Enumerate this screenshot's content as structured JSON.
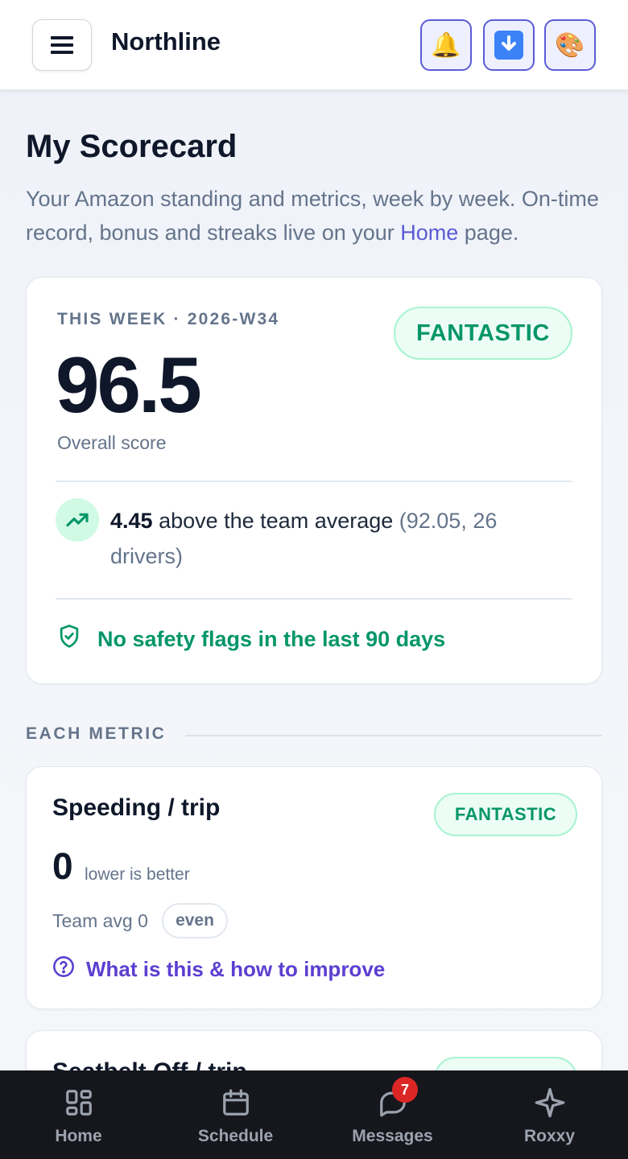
{
  "header": {
    "app_title": "Northline",
    "buttons": [
      {
        "icon": "bell-icon",
        "glyph": "🔔"
      },
      {
        "icon": "download-icon",
        "glyph": "⬇"
      },
      {
        "icon": "palette-icon",
        "glyph": "🎨"
      }
    ]
  },
  "page": {
    "title": "My Scorecard",
    "desc_before": "Your Amazon standing and metrics, week by week. On-time record, bonus and streaks live on your ",
    "desc_link": "Home",
    "desc_after": " page."
  },
  "summary": {
    "week_label": "THIS WEEK · 2026-W34",
    "score": "96.5",
    "score_label": "Overall score",
    "tier": "FANTASTIC",
    "delta": "4.45",
    "delta_text": " above the team average ",
    "team_info": "(92.05, 26 drivers)",
    "safety": "No safety flags in the last 90 days"
  },
  "section": {
    "label": "EACH METRIC"
  },
  "metrics": [
    {
      "title": "Speeding / trip",
      "tier": "FANTASTIC",
      "value": "0",
      "hint": "lower is better",
      "team_avg": "Team avg 0",
      "compare": "even",
      "help": "What is this & how to improve"
    },
    {
      "title": "Seatbelt Off / trip",
      "tier": "FANTASTIC"
    }
  ],
  "nav": [
    {
      "label": "Home",
      "icon": "grid-icon"
    },
    {
      "label": "Schedule",
      "icon": "calendar-icon"
    },
    {
      "label": "Messages",
      "icon": "chat-icon",
      "badge": "7"
    },
    {
      "label": "Roxxy",
      "icon": "sparkle-icon"
    }
  ],
  "colors": {
    "accent": "#5b5bd6",
    "success": "#059669",
    "nav_bg": "#16171c",
    "badge": "#dc2626"
  }
}
